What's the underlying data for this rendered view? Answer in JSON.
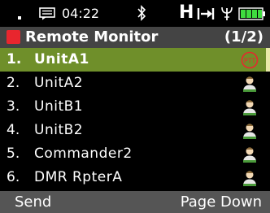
{
  "status_bar": {
    "time": "04:22",
    "h_indicator": "H",
    "icons": [
      "signal-dot-icon",
      "message-icon",
      "bluetooth-icon",
      "arrow-bar-icon",
      "antenna-icon",
      "battery-icon"
    ]
  },
  "title_bar": {
    "title": "Remote Monitor",
    "page_indicator": "(1/2)",
    "accent_color": "#e8262e"
  },
  "list": {
    "selected_index": 0,
    "selected_color": "#6f8f2a",
    "items": [
      {
        "number": "1.",
        "name": "UnitA1",
        "icon": "ptt-icon"
      },
      {
        "number": "2.",
        "name": "UnitA2",
        "icon": "contact-icon"
      },
      {
        "number": "3.",
        "name": "UnitB1",
        "icon": "contact-icon"
      },
      {
        "number": "4.",
        "name": "UnitB2",
        "icon": "contact-icon"
      },
      {
        "number": "5.",
        "name": "Commander2",
        "icon": "contact-icon"
      },
      {
        "number": "6.",
        "name": "DMR RpterA",
        "icon": "contact-icon"
      }
    ]
  },
  "softkeys": {
    "left": "Send",
    "right": "Page Down"
  }
}
